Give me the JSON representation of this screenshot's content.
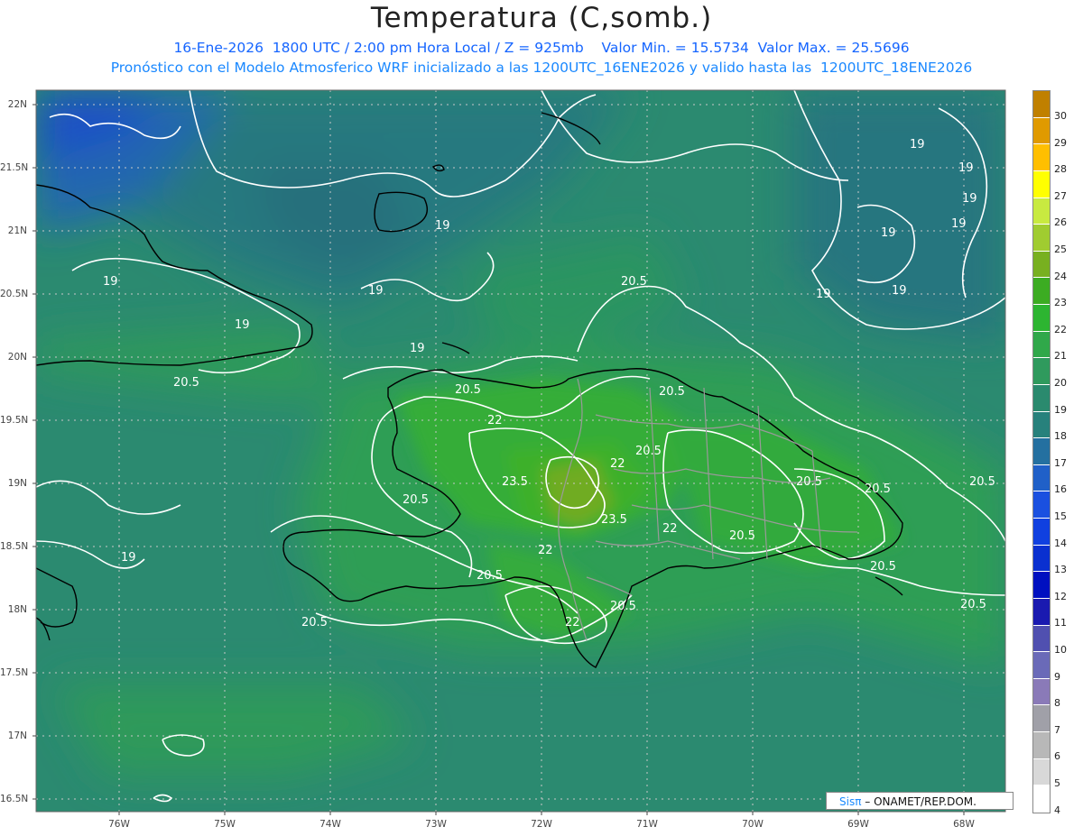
{
  "title": "Temperatura (C,somb.)",
  "subtitle1": "16-Ene-2026  1800 UTC / 2:00 pm Hora Local / Z = 925mb    Valor Min. = 15.5734  Valor Max. = 25.5696",
  "subtitle2": "Pronóstico con el Modelo Atmosferico WRF inicializado a las 1200UTC_16ENE2026 y valido hasta las  1200UTC_18ENE2026",
  "lat_labels": [
    "22N",
    "21.5N",
    "21N",
    "20.5N",
    "20N",
    "19.5N",
    "19N",
    "18.5N",
    "18N",
    "17.5N",
    "17N",
    "16.5N"
  ],
  "lon_labels": [
    "76W",
    "75W",
    "74W",
    "73W",
    "72W",
    "71W",
    "70W",
    "69W",
    "68W"
  ],
  "colorbar": {
    "labels": [
      "30",
      "29",
      "28",
      "27",
      "26",
      "25",
      "24",
      "23",
      "22",
      "21",
      "20",
      "19",
      "18",
      "17",
      "16",
      "15",
      "14",
      "13",
      "12",
      "11",
      "10",
      "9",
      "8",
      "7",
      "6",
      "5",
      "4"
    ],
    "colors": [
      "#c08000",
      "#e09a00",
      "#ffbf00",
      "#ffff00",
      "#c8ea40",
      "#a0cc30",
      "#78b020",
      "#3cac22",
      "#2db531",
      "#30a84a",
      "#2f9a5d",
      "#2a8a6e",
      "#27817c",
      "#2470a0",
      "#2060c8",
      "#1a50e0",
      "#1040e0",
      "#0a30d0",
      "#0010c0",
      "#1a1ab0",
      "#5050b0",
      "#6a6ab8",
      "#8a7ab8",
      "#a0a0a8",
      "#b8b8b8",
      "#d8d8d8",
      "#ffffff"
    ]
  },
  "contour_labels": [
    "19",
    "19",
    "19",
    "19",
    "19",
    "19",
    "19",
    "19",
    "19",
    "19",
    "19",
    "19",
    "19",
    "20.5",
    "20.5",
    "20.5",
    "20.5",
    "20.5",
    "20.5",
    "20.5",
    "20.5",
    "20.5",
    "20.5",
    "20.5",
    "20.5",
    "20.5",
    "20.5",
    "22",
    "22",
    "22",
    "22",
    "22",
    "23.5",
    "23.5"
  ],
  "credit": {
    "sis": "Sis",
    "pi": "π",
    "org": "– ONAMET/REP.DOM."
  }
}
